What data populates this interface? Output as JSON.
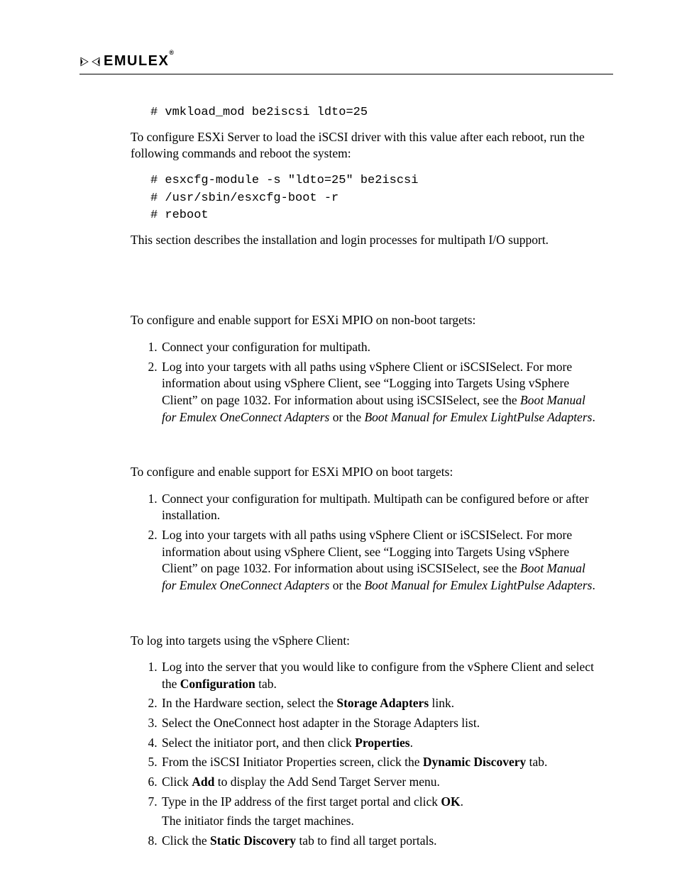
{
  "brand": {
    "name": "EMULEX"
  },
  "code": {
    "vmkload": "# vmkload_mod be2iscsi ldto=25",
    "esxcfg_module": "# esxcfg-module -s \"ldto=25\" be2iscsi",
    "esxcfg_boot": "# /usr/sbin/esxcfg-boot -r",
    "reboot": "# reboot"
  },
  "para": {
    "configure_esxi": "To configure ESXi Server to load the iSCSI driver with this value after each reboot, run the following commands and reboot the system:",
    "section_intro": "This section describes the installation and login processes for multipath I/O support.",
    "nonboot_intro": "To configure and enable support for ESXi MPIO on non-boot targets:",
    "boot_intro": "To configure and enable support for ESXi MPIO on boot targets:",
    "login_intro": "To log into targets using the vSphere Client:"
  },
  "nonboot": {
    "step1": "Connect your configuration for multipath.",
    "step2_a": "Log into your targets with all paths using vSphere Client or iSCSISelect. For more information about using vSphere Client, see “Logging into Targets Using vSphere Client” on page 1032. For information about using iSCSISelect, see the ",
    "step2_italic1": "Boot Manual for Emulex OneConnect Adapters",
    "step2_b": " or the ",
    "step2_italic2": "Boot Manual for Emulex LightPulse Adapters",
    "step2_c": "."
  },
  "boot": {
    "step1": "Connect your configuration for multipath. Multipath can be configured before or after installation.",
    "step2_a": "Log into your targets with all paths using vSphere Client or iSCSISelect. For more information about using vSphere Client, see “Logging into Targets Using vSphere Client” on page 1032. For information about using iSCSISelect, see the ",
    "step2_italic1": "Boot Manual for Emulex OneConnect Adapters",
    "step2_b": " or the ",
    "step2_italic2": "Boot Manual for Emulex LightPulse Adapters",
    "step2_c": "."
  },
  "login": {
    "step1_a": "Log into the server that you would like to configure from the vSphere Client and select the ",
    "step1_bold": "Configuration",
    "step1_b": " tab.",
    "step2_a": "In the Hardware section, select the ",
    "step2_bold": "Storage Adapters",
    "step2_b": " link.",
    "step3": "Select the OneConnect host adapter in the Storage Adapters list.",
    "step4_a": "Select the initiator port, and then click ",
    "step4_bold": "Properties",
    "step4_b": ".",
    "step5_a": "From the iSCSI Initiator Properties screen, click the ",
    "step5_bold": "Dynamic Discovery",
    "step5_b": " tab.",
    "step6_a": "Click ",
    "step6_bold": "Add",
    "step6_b": " to display the Add Send Target Server menu.",
    "step7_a": "Type in the IP address of the first target portal and click ",
    "step7_bold": "OK",
    "step7_b": ".",
    "step7_follow": "The initiator finds the target machines.",
    "step8_a": "Click the ",
    "step8_bold": "Static Discovery",
    "step8_b": " tab to find all target portals."
  }
}
